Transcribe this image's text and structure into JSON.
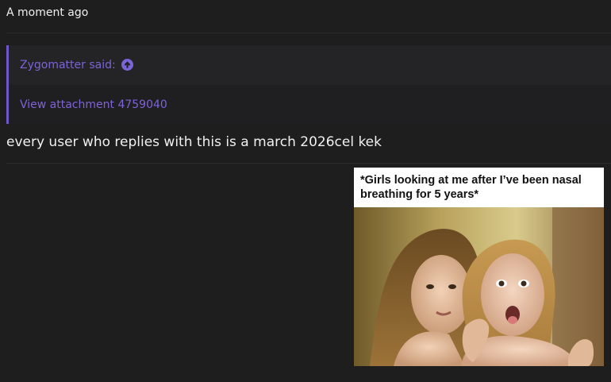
{
  "post": {
    "timestamp": "A moment ago",
    "body_text": "every user who replies with this is a march 2026cel kek"
  },
  "quote": {
    "author_label": "Zygomatter said:",
    "arrow_icon": "arrow-up-circle-icon",
    "attachment_link": "View attachment 4759040"
  },
  "image": {
    "caption": "*Girls looking at me after I’ve been nasal breathing for 5 years*"
  },
  "colors": {
    "background": "#1e1e1f",
    "quote_accent": "#6f56c9",
    "link": "#7d63d8",
    "text": "#e8e8e8"
  }
}
